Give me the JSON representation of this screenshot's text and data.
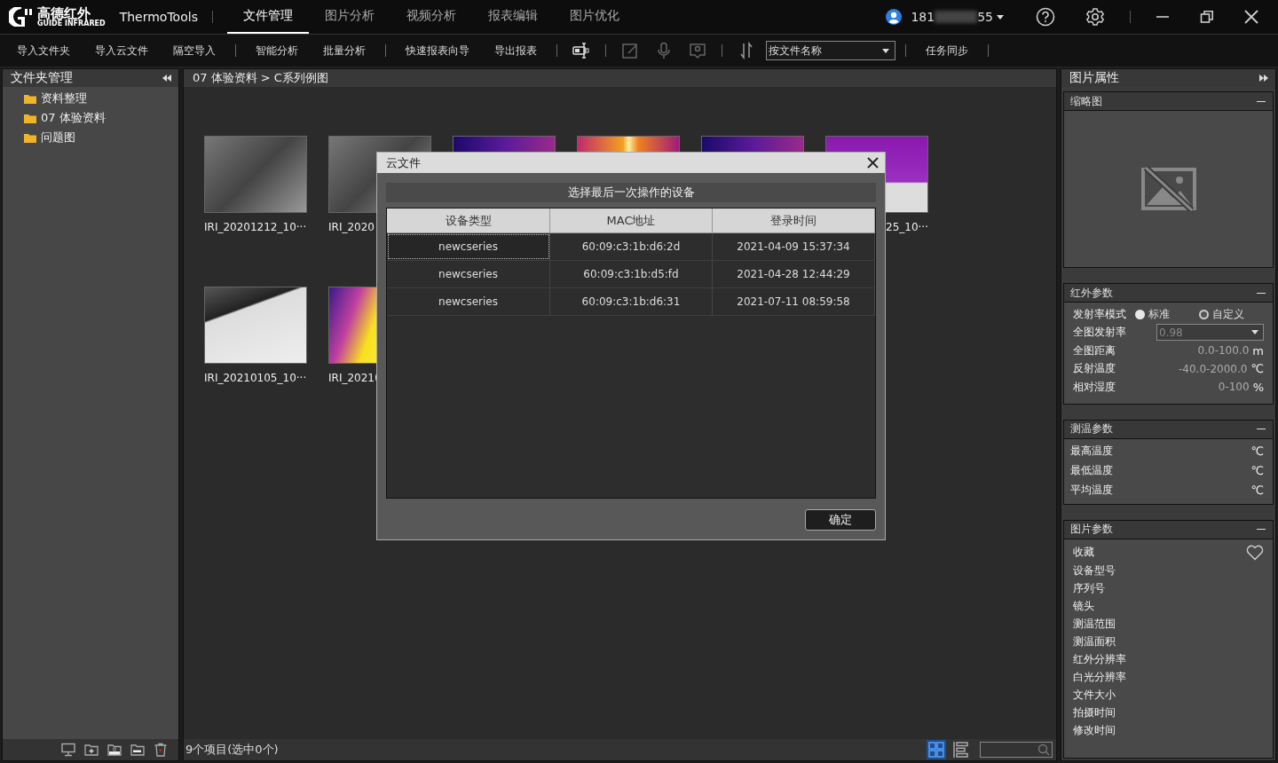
{
  "app": {
    "brand": "高德红外",
    "brand_sub": "GUIDE INFRARED",
    "name": "ThermoTools"
  },
  "nav_tabs": [
    {
      "label": "文件管理",
      "selected": true
    },
    {
      "label": "图片分析",
      "selected": false
    },
    {
      "label": "视频分析",
      "selected": false
    },
    {
      "label": "报表编辑",
      "selected": false
    },
    {
      "label": "图片优化",
      "selected": false
    }
  ],
  "user": {
    "id_start": "181",
    "id_end": "55"
  },
  "toolbar": [
    {
      "kind": "button",
      "label": "导入文件夹"
    },
    {
      "kind": "button",
      "label": "导入云文件"
    },
    {
      "kind": "button",
      "label": "隔空导入"
    },
    {
      "kind": "sep"
    },
    {
      "kind": "button",
      "label": "智能分析"
    },
    {
      "kind": "button",
      "label": "批量分析"
    },
    {
      "kind": "sep"
    },
    {
      "kind": "button",
      "label": "快速报表向导"
    },
    {
      "kind": "button",
      "label": "导出报表"
    },
    {
      "kind": "sep"
    },
    {
      "kind": "device"
    },
    {
      "kind": "sep"
    },
    {
      "kind": "edit"
    },
    {
      "kind": "mic"
    },
    {
      "kind": "pin"
    },
    {
      "kind": "sep"
    },
    {
      "kind": "sort"
    },
    {
      "kind": "select",
      "value": "按文件名称"
    },
    {
      "kind": "sep"
    },
    {
      "kind": "button",
      "label": "任务同步"
    },
    {
      "kind": "sep"
    }
  ],
  "folder_panel": {
    "title": "文件夹管理",
    "folders": [
      {
        "label": "资料整理"
      },
      {
        "label": "07 体验资料"
      },
      {
        "label": "问题图"
      }
    ]
  },
  "breadcrumb": "07 体验资料 > C系列例图",
  "thumbnails": [
    {
      "kind": "grayscale",
      "label": "IRI_20201212_10···"
    },
    {
      "kind": "grayscale",
      "label": "IRI_2020"
    },
    {
      "kind": "ironbow"
    },
    {
      "kind": "hot"
    },
    {
      "kind": "ironbow"
    },
    {
      "kind": "purple",
      "label": "25_10···"
    },
    {
      "kind": "screen",
      "label": "IRI_20210105_10···"
    },
    {
      "kind": "yellow",
      "label": "IRI_2021("
    }
  ],
  "dialog": {
    "title": "云文件",
    "heading": "选择最后一次操作的设备",
    "columns": [
      "设备类型",
      "MAC地址",
      "登录时间"
    ],
    "rows": [
      {
        "cells": [
          "newcseries",
          "60:09:c3:1b:d6:2d",
          "2021-04-09 15:37:34"
        ],
        "selected": true
      },
      {
        "cells": [
          "newcseries",
          "60:09:c3:1b:d5:fd",
          "2021-04-28 12:44:29"
        ],
        "selected": false
      },
      {
        "cells": [
          "newcseries",
          "60:09:c3:1b:d6:31",
          "2021-07-11 08:59:58"
        ],
        "selected": false
      }
    ],
    "ok": "确定"
  },
  "status": "9个项目(选中0个)",
  "views": [
    {
      "kind": "grid",
      "selected": true
    },
    {
      "kind": "list",
      "selected": false
    }
  ],
  "properties": {
    "title": "图片属性",
    "thumbnail": {
      "title": "缩略图"
    },
    "infrared": {
      "title": "红外参数",
      "mode_label": "发射率模式",
      "modes": [
        {
          "label": "标准",
          "selected": true
        },
        {
          "label": "自定义",
          "selected": false
        }
      ],
      "emissivity_label": "全图发射率",
      "emissivity": "0.98",
      "ranges": [
        {
          "label": "全图距离",
          "value": "0.0-100.0",
          "unit": "m"
        },
        {
          "label": "反射温度",
          "value": "-40.0-2000.0",
          "unit": "℃"
        },
        {
          "label": "相对湿度",
          "value": "0-100",
          "unit": "%"
        }
      ]
    },
    "measure": {
      "title": "测温参数",
      "rows": [
        {
          "label": "最高温度",
          "unit": "℃"
        },
        {
          "label": "最低温度",
          "unit": "℃"
        },
        {
          "label": "平均温度",
          "unit": "℃"
        }
      ]
    },
    "image": {
      "title": "图片参数",
      "favorite": "收藏",
      "rows": [
        "设备型号",
        "序列号",
        "镜头",
        "测温范围",
        "测温面积",
        "红外分辨率",
        "白光分辨率",
        "文件大小",
        "拍摄时间",
        "修改时间"
      ]
    }
  }
}
